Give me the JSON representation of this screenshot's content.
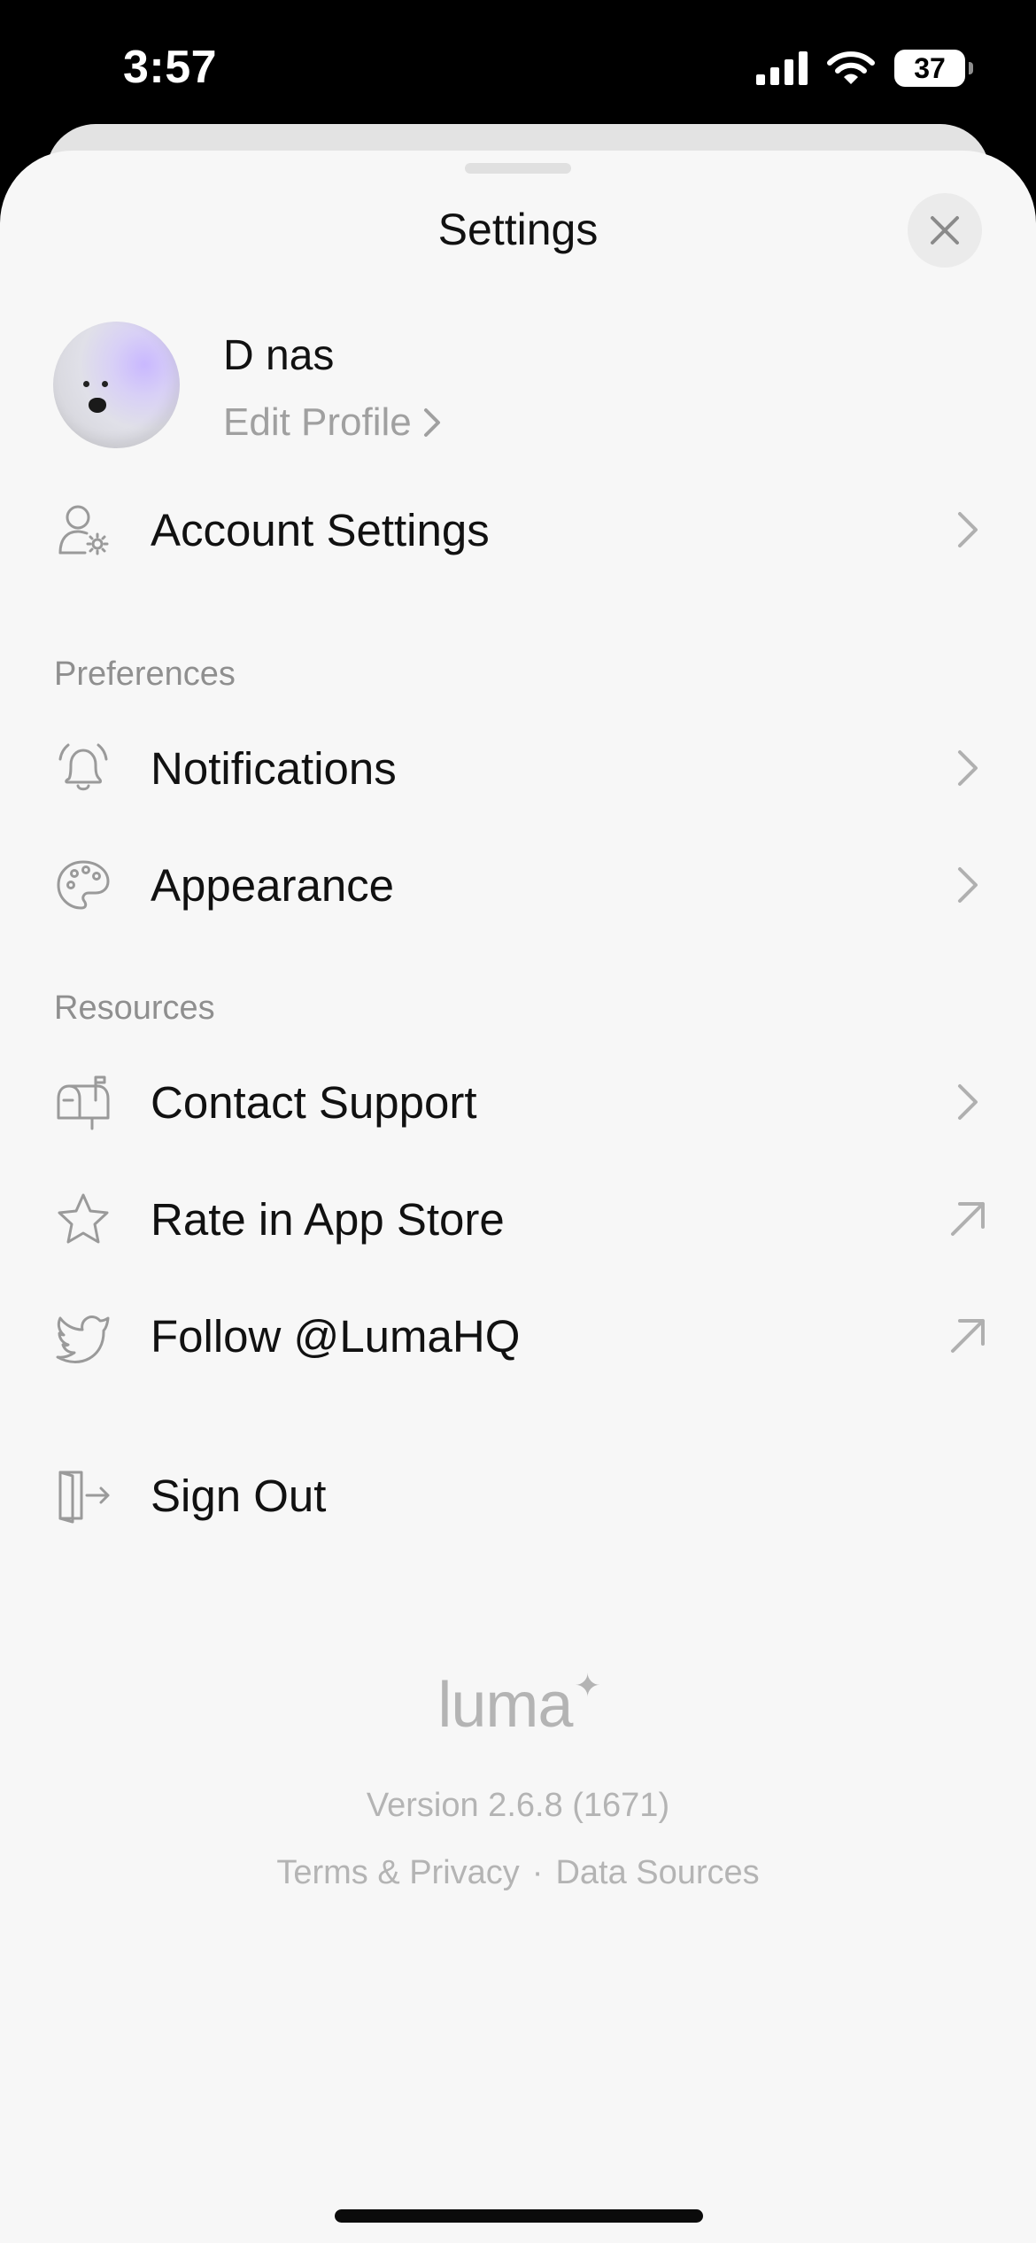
{
  "status_bar": {
    "time": "3:57",
    "battery": "37"
  },
  "sheet": {
    "title": "Settings"
  },
  "profile": {
    "name": "D nas",
    "edit_label": "Edit Profile"
  },
  "rows": {
    "account": {
      "label": "Account Settings"
    },
    "notifications": {
      "label": "Notifications"
    },
    "appearance": {
      "label": "Appearance"
    },
    "support": {
      "label": "Contact Support"
    },
    "rate": {
      "label": "Rate in App Store"
    },
    "follow": {
      "label": "Follow @LumaHQ"
    },
    "signout": {
      "label": "Sign Out"
    }
  },
  "sections": {
    "preferences": "Preferences",
    "resources": "Resources"
  },
  "footer": {
    "logo": "luma",
    "logo_spark": "✦",
    "version": "Version 2.6.8 (1671)",
    "terms": "Terms & Privacy",
    "separator": "·",
    "data_sources": "Data Sources"
  },
  "colors": {
    "sheet_background": "#f7f7f7",
    "secondary_text": "#8f8f8f",
    "icon_stroke": "#9a9a9a"
  },
  "icons": {
    "account": "person-gear-icon",
    "notifications": "bell-icon",
    "appearance": "palette-icon",
    "support": "mailbox-icon",
    "rate": "star-icon",
    "follow": "twitter-bird-icon",
    "signout": "door-exit-icon",
    "chevron": "chevron-right-icon",
    "external": "arrow-up-right-icon"
  }
}
